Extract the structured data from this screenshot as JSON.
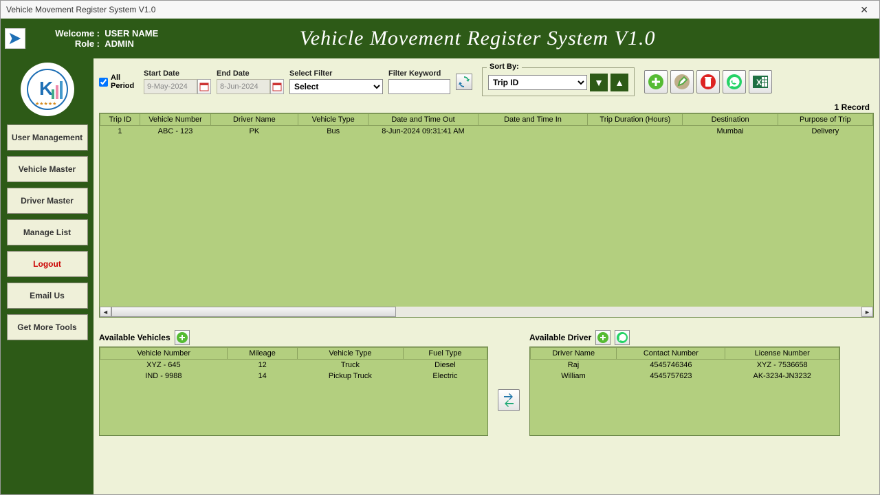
{
  "titlebar": {
    "title": "Vehicle Movement Register System V1.0"
  },
  "header": {
    "welcome_label": "Welcome :",
    "welcome_value": "USER NAME",
    "role_label": "Role :",
    "role_value": "ADMIN",
    "app_title": "Vehicle Movement Register System V1.0"
  },
  "sidebar": {
    "items": [
      {
        "label": "User Management"
      },
      {
        "label": "Vehicle Master"
      },
      {
        "label": "Driver Master"
      },
      {
        "label": "Manage List"
      },
      {
        "label": "Logout"
      },
      {
        "label": "Email Us"
      },
      {
        "label": "Get More Tools"
      }
    ]
  },
  "filters": {
    "all_period": "All Period",
    "start_date_label": "Start Date",
    "start_date_value": "9-May-2024",
    "end_date_label": "End Date",
    "end_date_value": "8-Jun-2024",
    "select_filter_label": "Select Filter",
    "select_filter_value": "Select",
    "filter_keyword_label": "Filter Keyword",
    "sort_by_label": "Sort By:",
    "sort_by_value": "Trip ID"
  },
  "record_count": "1 Record",
  "main_table": {
    "headers": [
      "Trip ID",
      "Vehicle Number",
      "Driver Name",
      "Vehicle Type",
      "Date and Time Out",
      "Date and Time In",
      "Trip Duration (Hours)",
      "Destination",
      "Purpose of Trip"
    ],
    "rows": [
      [
        "1",
        "ABC - 123",
        "PK",
        "Bus",
        "8-Jun-2024 09:31:41 AM",
        "",
        "",
        "Mumbai",
        "Delivery"
      ]
    ]
  },
  "vehicles_panel": {
    "title": "Available Vehicles",
    "headers": [
      "Vehicle Number",
      "Mileage",
      "Vehicle Type",
      "Fuel Type"
    ],
    "rows": [
      [
        "XYZ - 645",
        "12",
        "Truck",
        "Diesel"
      ],
      [
        "IND - 9988",
        "14",
        "Pickup Truck",
        "Electric"
      ]
    ]
  },
  "drivers_panel": {
    "title": "Available Driver",
    "headers": [
      "Driver Name",
      "Contact Number",
      "License Number"
    ],
    "rows": [
      [
        "Raj",
        "4545746346",
        "XYZ - 7536658"
      ],
      [
        "William",
        "4545757623",
        "AK-3234-JN3232"
      ]
    ]
  }
}
